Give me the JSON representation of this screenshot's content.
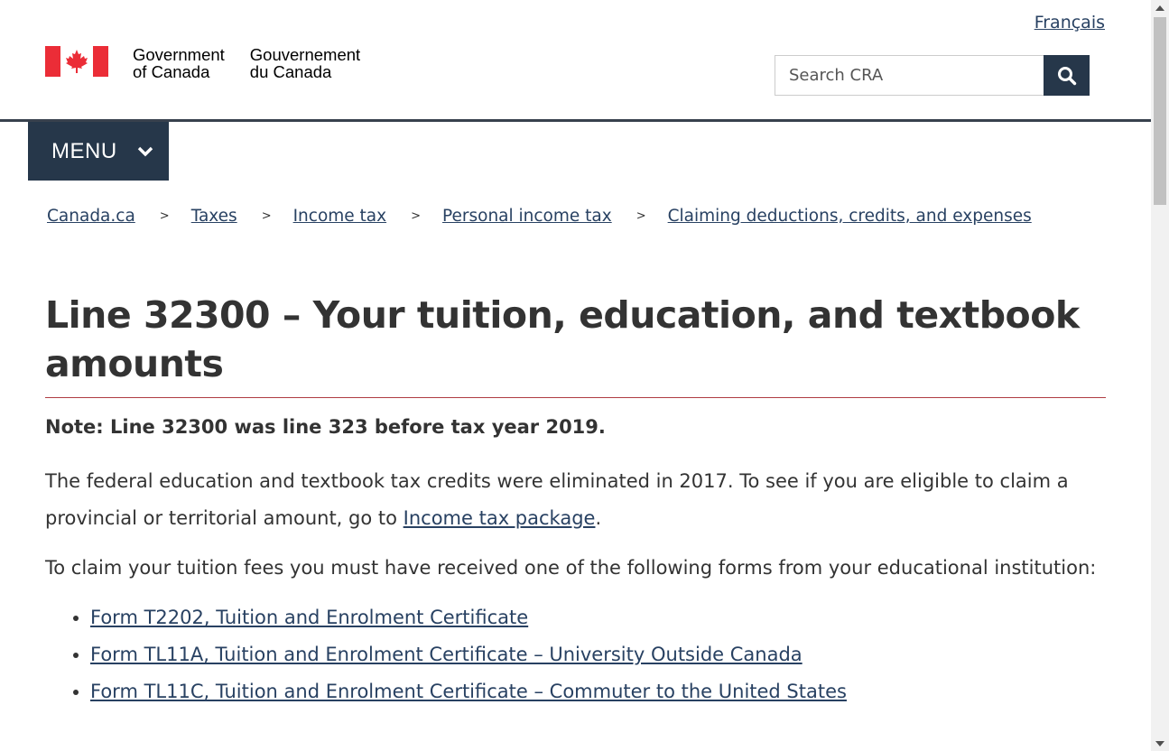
{
  "header": {
    "language_link": "Français",
    "signature_en_line1": "Government",
    "signature_en_line2": "of Canada",
    "signature_fr_line1": "Gouvernement",
    "signature_fr_line2": "du Canada",
    "search_placeholder": "Search CRA",
    "search_icon": "search-icon",
    "flag_colors": {
      "red": "#eb2d37",
      "white": "#ffffff"
    }
  },
  "nav": {
    "menu_label": "MENU",
    "menu_icon": "chevron-down-icon"
  },
  "breadcrumb": {
    "separator": ">",
    "items": [
      "Canada.ca",
      "Taxes",
      "Income tax",
      "Personal income tax",
      "Claiming deductions, credits, and expenses"
    ]
  },
  "main": {
    "title": "Line 32300 – Your tuition, education, and textbook amounts",
    "note": "Note: Line 32300 was line 323 before tax year 2019.",
    "para1_text": "The federal education and textbook tax credits were eliminated in 2017. To see if you are eligible to claim a provincial or territorial amount, go to ",
    "para1_link": "Income tax package",
    "para1_end": ".",
    "para2": "To claim your tuition fees you must have received one of the following forms from your educational institution:",
    "forms": [
      "Form T2202, Tuition and Enrolment Certificate",
      "Form TL11A, Tuition and Enrolment Certificate – University Outside Canada",
      "Form TL11C, Tuition and Enrolment Certificate – Commuter to the United States"
    ]
  },
  "colors": {
    "link": "#284162",
    "nav_background": "#26374a",
    "title_rule": "#af3c43",
    "text": "#333333"
  }
}
